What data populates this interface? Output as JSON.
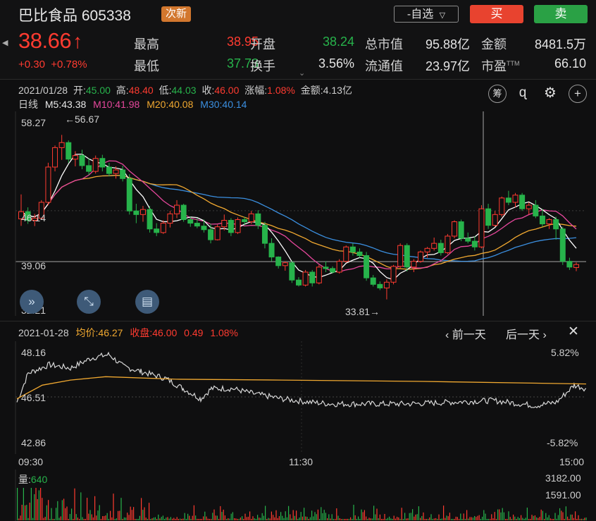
{
  "header": {
    "stock_name": "巴比食品 605338",
    "new_badge": "次新",
    "watch_label": "-自选",
    "buy_label": "买",
    "sell_label": "卖",
    "price": "38.66",
    "change": "+0.30  +0.78%",
    "stats": [
      {
        "label": "最高",
        "value": "38.95",
        "color": "red"
      },
      {
        "label": "开盘",
        "value": "38.24",
        "color": "grn"
      },
      {
        "label": "总市值",
        "value": "95.88亿",
        "color": "wht"
      },
      {
        "label": "金额",
        "value": "8481.5万",
        "color": "wht"
      },
      {
        "label": "最低",
        "value": "37.73",
        "color": "grn"
      },
      {
        "label": "换手",
        "value": "3.56%",
        "color": "wht"
      },
      {
        "label": "流通值",
        "value": "23.97亿",
        "color": "wht"
      },
      {
        "label": "市盈",
        "value": "66.10",
        "color": "wht"
      }
    ],
    "pe_mark": "TTM"
  },
  "ohlc": {
    "date": "2021/01/28",
    "open_label": "开:",
    "open": "45.00",
    "high_label": "高:",
    "high": "48.40",
    "low_label": "低:",
    "low": "44.03",
    "close_label": "收:",
    "close": "46.00",
    "chg_label": "涨幅:",
    "chg": "1.08%",
    "amt_label": "金额:",
    "amt": "4.13亿"
  },
  "ma": {
    "period": "日线",
    "m5": "M5:43.38",
    "m10": "M10:41.98",
    "m20": "M20:40.08",
    "m30": "M30:40.14",
    "colors": {
      "m5": "#ffffff",
      "m10": "#e6479c",
      "m20": "#f0a830",
      "m30": "#3b8fe0"
    }
  },
  "kline": {
    "y_labels": [
      "58.27",
      "46.14",
      "39.06",
      "32.21"
    ],
    "max_note": "←56.67",
    "min_note": "33.81→"
  },
  "intraday": {
    "date": "2021-01-28",
    "avg_label": "均价:",
    "avg": "46.27",
    "close_label": "收盘:",
    "close": "46.00",
    "chg": "0.49",
    "pct": "1.08%",
    "prev_day": "前一天",
    "next_day": "后一天",
    "y_left": [
      "48.16",
      "46.51",
      "42.86"
    ],
    "y_right": [
      "5.82%",
      "-5.82%"
    ],
    "x_labels": [
      "09:30",
      "11:30",
      "15:00"
    ]
  },
  "volume": {
    "label": "量:",
    "value": "640",
    "y_labels": [
      "3182.00",
      "1591.00"
    ]
  },
  "chart_data": [
    {
      "type": "candlestick",
      "ylim": [
        32.21,
        58.27
      ],
      "y_ticks": [
        58.27,
        46.14,
        39.06,
        32.21
      ],
      "max_label": 56.67,
      "min_label": 33.81,
      "ohlc": [
        [
          45.0,
          48.4,
          44.03,
          46.0
        ],
        [
          46.0,
          46.6,
          44.3,
          44.8
        ],
        [
          44.8,
          45.7,
          44.0,
          45.1
        ],
        [
          45.1,
          47.6,
          44.9,
          47.3
        ],
        [
          47.3,
          52.8,
          46.9,
          52.2
        ],
        [
          52.2,
          55.2,
          51.6,
          54.9
        ],
        [
          54.9,
          56.67,
          53.2,
          55.6
        ],
        [
          55.6,
          55.9,
          52.8,
          53.3
        ],
        [
          53.3,
          54.4,
          52.3,
          53.8
        ],
        [
          53.8,
          54.6,
          51.9,
          52.4
        ],
        [
          52.4,
          53.4,
          51.1,
          51.6
        ],
        [
          51.6,
          53.8,
          51.3,
          53.4
        ],
        [
          53.4,
          53.9,
          51.6,
          52.2
        ],
        [
          52.2,
          52.8,
          50.9,
          51.3
        ],
        [
          51.3,
          52.3,
          50.6,
          51.8
        ],
        [
          51.8,
          52.4,
          50.2,
          50.6
        ],
        [
          50.6,
          51.2,
          45.6,
          46.1
        ],
        [
          46.1,
          47.1,
          44.4,
          45.6
        ],
        [
          45.6,
          46.8,
          44.6,
          46.3
        ],
        [
          46.3,
          46.8,
          43.1,
          43.6
        ],
        [
          43.6,
          44.4,
          42.6,
          43.1
        ],
        [
          43.1,
          44.8,
          42.9,
          44.4
        ],
        [
          44.4,
          46.1,
          43.8,
          45.7
        ],
        [
          45.7,
          47.6,
          45.1,
          46.9
        ],
        [
          46.9,
          47.1,
          44.6,
          44.9
        ],
        [
          44.9,
          45.3,
          43.9,
          44.4
        ],
        [
          44.4,
          45.1,
          43.7,
          44.0
        ],
        [
          44.0,
          44.9,
          43.1,
          43.5
        ],
        [
          43.5,
          44.3,
          41.6,
          42.1
        ],
        [
          42.1,
          44.2,
          42.0,
          43.9
        ],
        [
          43.9,
          45.6,
          43.4,
          44.8
        ],
        [
          44.8,
          45.1,
          42.6,
          43.1
        ],
        [
          43.1,
          45.2,
          42.9,
          44.9
        ],
        [
          44.9,
          45.3,
          44.1,
          44.6
        ],
        [
          44.6,
          46.1,
          44.3,
          45.7
        ],
        [
          45.7,
          46.2,
          43.6,
          44.1
        ],
        [
          44.1,
          44.6,
          40.9,
          41.6
        ],
        [
          41.6,
          42.3,
          39.1,
          39.7
        ],
        [
          39.7,
          39.8,
          38.1,
          38.5
        ],
        [
          38.5,
          39.1,
          37.8,
          38.9
        ],
        [
          38.9,
          39.2,
          36.1,
          36.5
        ],
        [
          36.5,
          36.9,
          35.6,
          35.8
        ],
        [
          35.8,
          37.9,
          35.6,
          37.6
        ],
        [
          37.6,
          37.9,
          35.6,
          36.1
        ],
        [
          36.1,
          38.6,
          35.9,
          38.3
        ],
        [
          38.3,
          39.1,
          37.6,
          38.1
        ],
        [
          38.1,
          38.4,
          37.4,
          37.6
        ],
        [
          37.6,
          39.4,
          37.4,
          39.1
        ],
        [
          39.1,
          41.3,
          38.9,
          41.1
        ],
        [
          41.1,
          41.6,
          39.9,
          40.4
        ],
        [
          40.4,
          40.9,
          39.6,
          39.9
        ],
        [
          39.9,
          40.4,
          36.4,
          36.8
        ],
        [
          36.8,
          37.2,
          35.6,
          35.9
        ],
        [
          35.9,
          36.3,
          35.1,
          35.4
        ],
        [
          35.4,
          36.6,
          33.81,
          36.2
        ],
        [
          36.2,
          38.6,
          35.9,
          38.4
        ],
        [
          38.4,
          41.6,
          38.1,
          41.3
        ],
        [
          41.3,
          41.6,
          37.7,
          38.3
        ],
        [
          38.3,
          39.4,
          37.6,
          39.1
        ],
        [
          39.1,
          40.6,
          38.9,
          40.4
        ],
        [
          40.4,
          41.1,
          39.6,
          40.9
        ],
        [
          40.9,
          42.4,
          40.6,
          41.6
        ],
        [
          41.6,
          42.1,
          39.9,
          40.3
        ],
        [
          40.3,
          42.9,
          40.1,
          42.6
        ],
        [
          42.6,
          44.8,
          42.3,
          44.6
        ],
        [
          44.6,
          44.9,
          41.9,
          42.3
        ],
        [
          42.3,
          43.1,
          41.6,
          41.9
        ],
        [
          41.9,
          42.6,
          40.6,
          41.1
        ],
        [
          41.1,
          46.9,
          40.9,
          46.4
        ],
        [
          46.4,
          47.1,
          43.6,
          44.1
        ],
        [
          44.1,
          46.1,
          43.9,
          45.6
        ],
        [
          45.6,
          48.1,
          45.3,
          47.9
        ],
        [
          47.9,
          48.9,
          46.9,
          47.3
        ],
        [
          47.3,
          48.6,
          46.6,
          48.3
        ],
        [
          48.3,
          48.6,
          46.1,
          46.4
        ],
        [
          46.4,
          47.3,
          45.6,
          46.9
        ],
        [
          46.9,
          47.6,
          45.1,
          45.4
        ],
        [
          45.4,
          46.4,
          43.9,
          44.3
        ],
        [
          44.3,
          45.1,
          43.6,
          44.9
        ],
        [
          44.9,
          45.3,
          42.1,
          43.6
        ],
        [
          43.6,
          43.9,
          38.6,
          39.1
        ],
        [
          39.1,
          39.6,
          37.9,
          38.3
        ],
        [
          38.24,
          38.95,
          37.73,
          38.66
        ]
      ]
    },
    {
      "type": "line",
      "x_labels": [
        "09:30",
        "11:30",
        "15:00"
      ],
      "ylim": [
        42.86,
        48.16
      ],
      "reference": 45.51
    },
    {
      "type": "bar",
      "ylim": [
        0,
        3182.0
      ],
      "y_ticks": [
        3182.0,
        1591.0
      ],
      "last_value": 640
    }
  ]
}
